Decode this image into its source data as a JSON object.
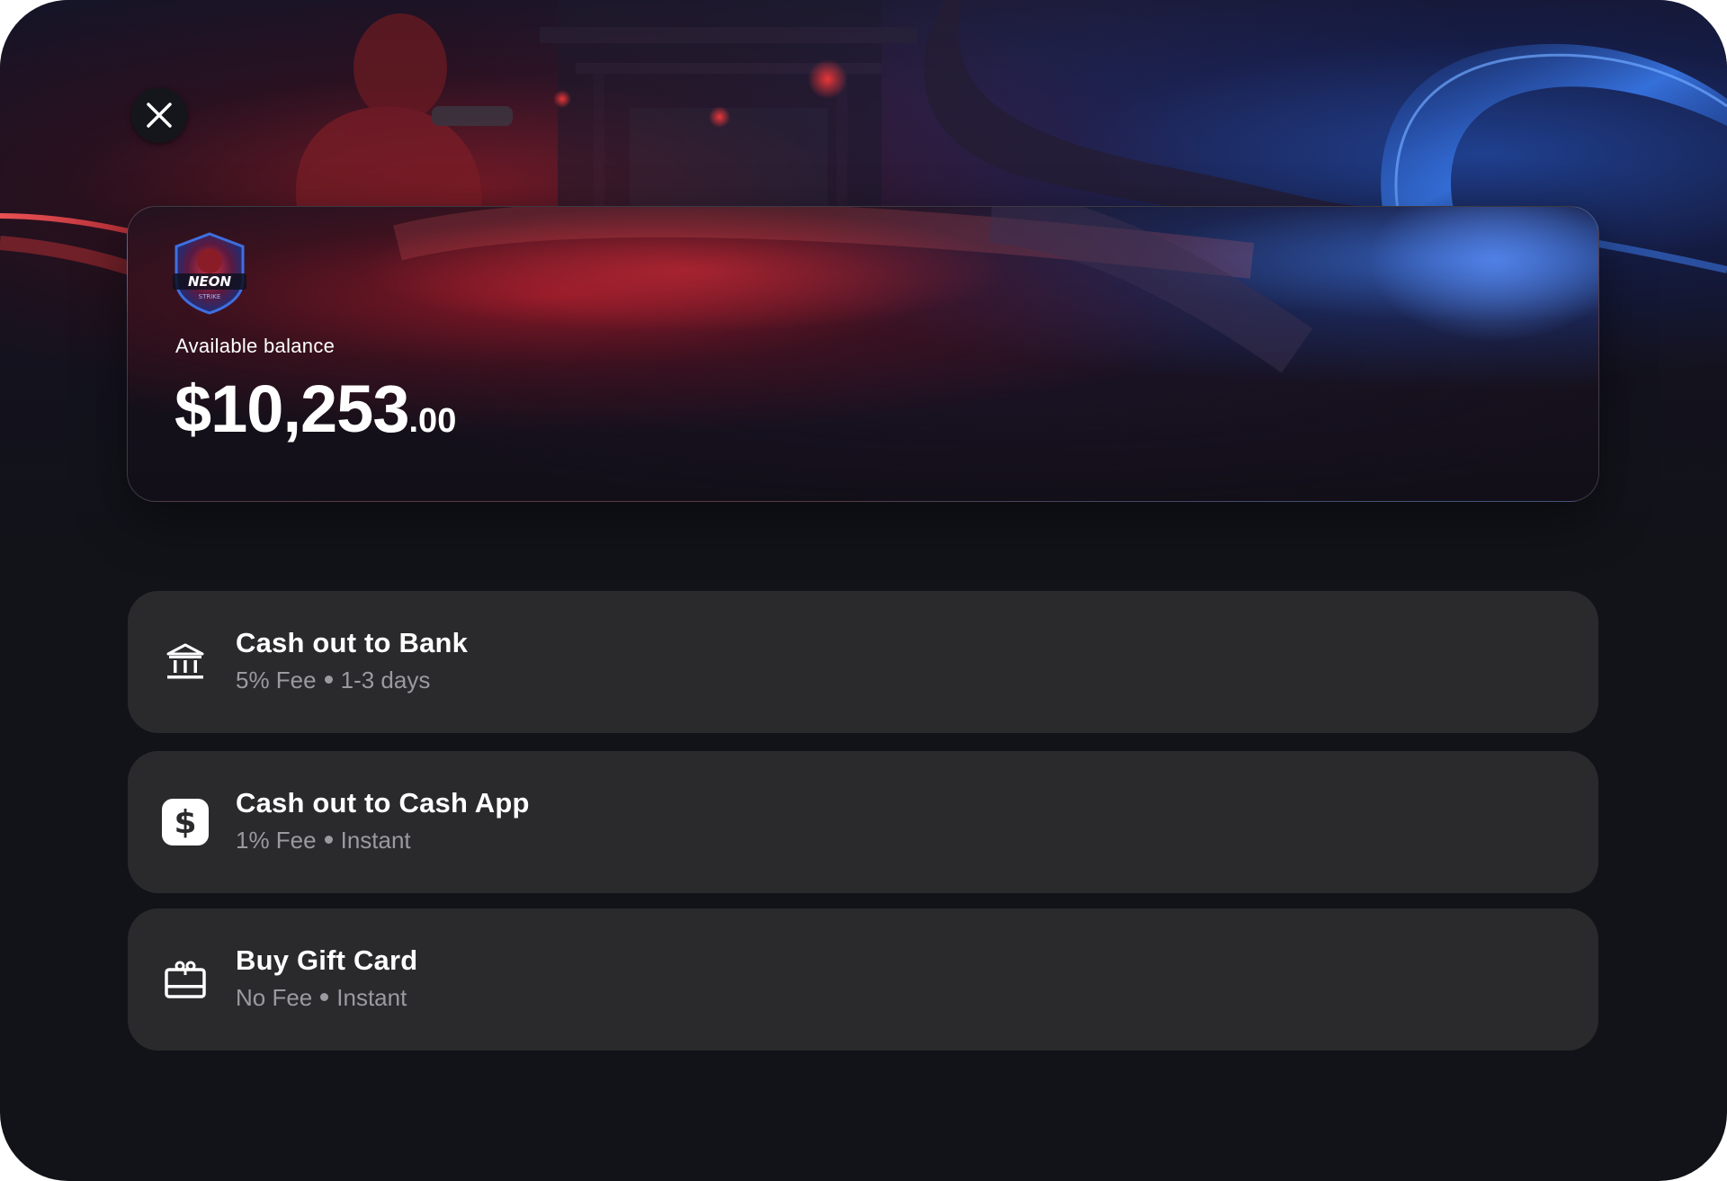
{
  "balance": {
    "label": "Available balance",
    "amount_main": "$10,253",
    "amount_cents": ".00"
  },
  "game": {
    "logo_text": "NEON",
    "logo_subtext": "STRIKE"
  },
  "options": [
    {
      "icon": "bank-icon",
      "title": "Cash out to Bank",
      "fee": "5% Fee",
      "speed": "1-3 days"
    },
    {
      "icon": "cash-app-icon",
      "title": "Cash out to Cash App",
      "fee": "1% Fee",
      "speed": "Instant"
    },
    {
      "icon": "gift-card-icon",
      "title": "Buy Gift Card",
      "fee": "No Fee",
      "speed": "Instant"
    }
  ],
  "colors": {
    "background": "#121319",
    "option_background": "#2a2a2c",
    "subtitle": "#9a9aa0",
    "accent_red": "#c8202c",
    "accent_blue": "#2f6ee8"
  }
}
